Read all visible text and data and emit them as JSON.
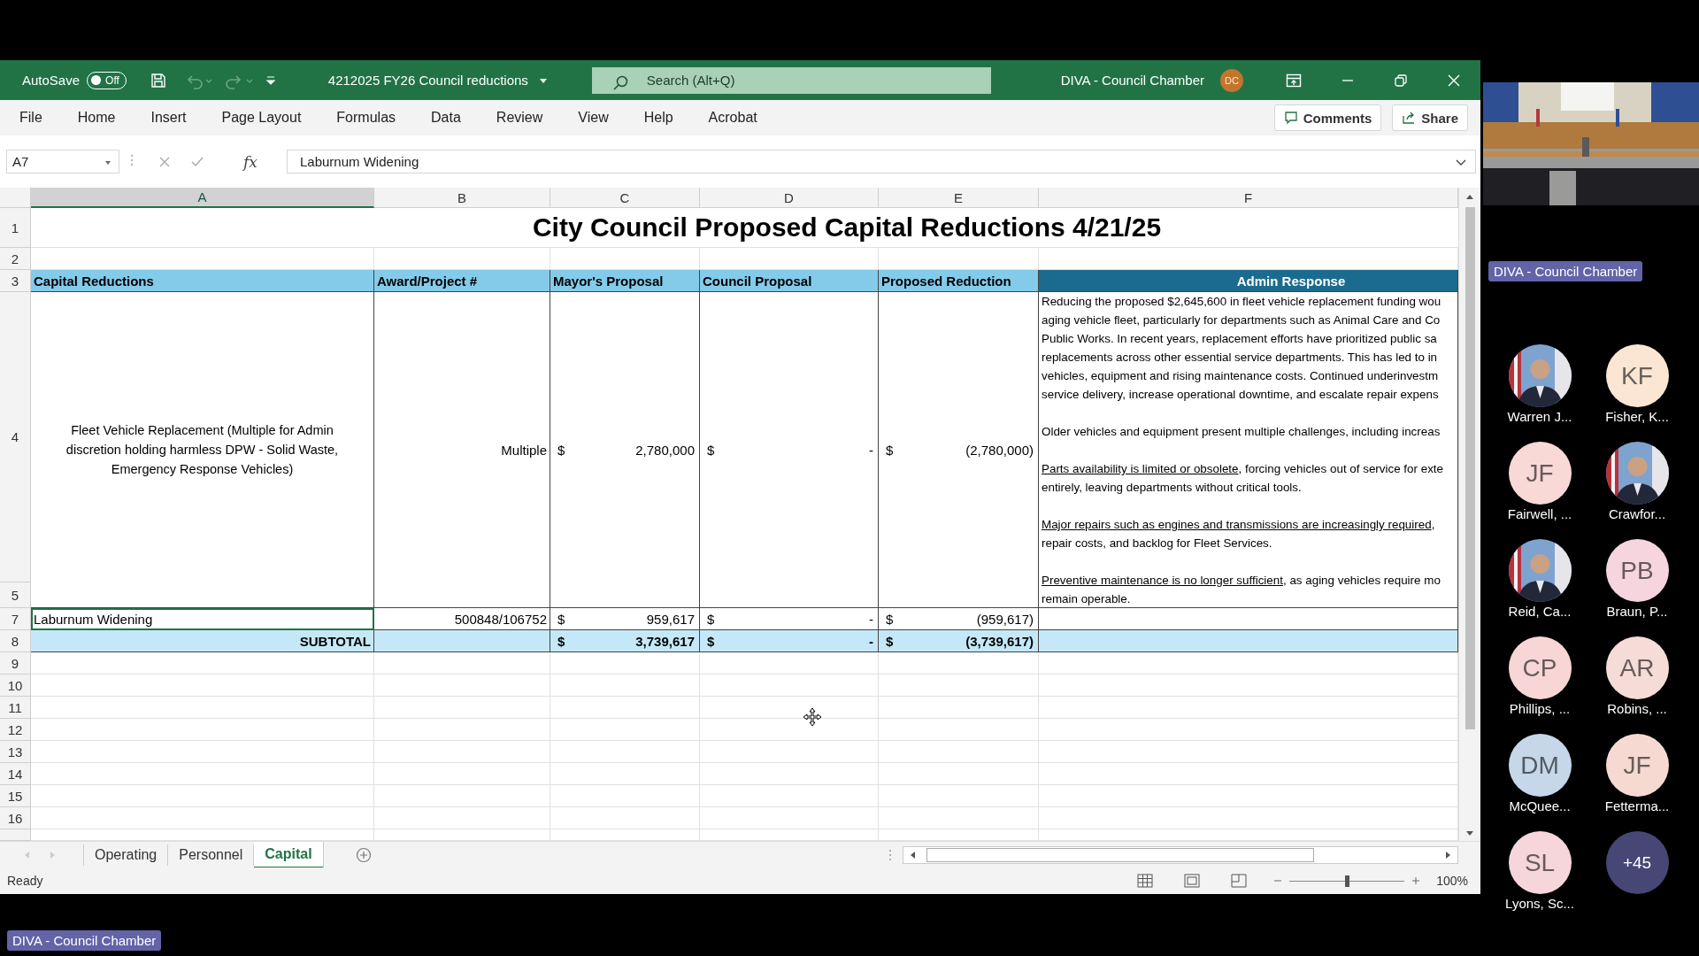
{
  "title_bar": {
    "autosave": {
      "label": "AutoSave",
      "state_label": "Off",
      "on": false
    },
    "document_title": "4212025 FY26 Council reductions",
    "search": {
      "placeholder": "Search (Alt+Q)"
    },
    "account": {
      "name": "DIVA - Council Chamber",
      "initials": "DC"
    }
  },
  "menu": [
    "File",
    "Home",
    "Insert",
    "Page Layout",
    "Formulas",
    "Data",
    "Review",
    "View",
    "Help",
    "Acrobat"
  ],
  "comments_button": "Comments",
  "share_button": "Share",
  "formula_bar": {
    "name_box": "A7",
    "function_label": "fx",
    "formula": "Laburnum Widening"
  },
  "columns": [
    {
      "label": "A",
      "selected": true
    },
    {
      "label": "B",
      "selected": false
    },
    {
      "label": "C",
      "selected": false
    },
    {
      "label": "D",
      "selected": false
    },
    {
      "label": "E",
      "selected": false
    },
    {
      "label": "F",
      "selected": false
    }
  ],
  "row_numbers": [
    "1",
    "2",
    "3",
    "4",
    "5",
    "7",
    "8",
    "9",
    "10",
    "11",
    "12",
    "13",
    "14",
    "15",
    "16"
  ],
  "sheet": {
    "title": "City Council Proposed Capital Reductions 4/21/25",
    "headers": [
      "Capital Reductions",
      "Award/Project #",
      "Mayor's Proposal",
      "Council Proposal",
      "Proposed Reduction",
      "Admin Response"
    ],
    "rows": [
      {
        "kind": "merged",
        "selected": false,
        "description": "Fleet Vehicle Replacement (Multiple for Admin discretion holding harmless DPW - Solid Waste, Emergency Response Vehicles)",
        "project": "Multiple",
        "mayor": {
          "currency": "$",
          "amount": "2,780,000"
        },
        "council": {
          "currency": "$",
          "amount": "-"
        },
        "reduction": {
          "currency": "$",
          "amount": "(2,780,000)"
        },
        "admin_response": [
          {
            "lines": [
              {
                "text": "Reducing the proposed $2,645,600 in fleet vehicle replacement funding wou"
              },
              {
                "text": "aging vehicle fleet, particularly for departments such as Animal Care and Co"
              },
              {
                "text": "Public Works. In recent years, replacement efforts have prioritized public sa"
              },
              {
                "text": "replacements across other essential service departments. This has led to in"
              },
              {
                "text": "vehicles, equipment and rising maintenance costs. Continued underinvestm"
              },
              {
                "text": "service delivery, increase operational downtime, and escalate repair expens"
              }
            ]
          },
          {
            "lines": [
              {
                "text": "Older vehicles and equipment present multiple challenges, including increas"
              }
            ]
          },
          {
            "lines": [
              {
                "underlined": "Parts availability is limited or obsolete",
                "text": ", forcing vehicles out of service for exte"
              },
              {
                "text": "entirely, leaving departments without critical tools."
              }
            ]
          },
          {
            "lines": [
              {
                "underlined": "Major repairs such as engines and transmissions are increasingly required",
                "text": ","
              },
              {
                "text": "repair costs, and backlog for Fleet Services."
              }
            ]
          },
          {
            "lines": [
              {
                "underlined": "Preventive maintenance is no longer sufficient",
                "text": ", as aging vehicles require mo"
              },
              {
                "text": "remain operable."
              }
            ]
          }
        ]
      },
      {
        "kind": "single",
        "selected": true,
        "description": "Laburnum Widening",
        "project": "500848/106752",
        "mayor": {
          "currency": "$",
          "amount": "959,617"
        },
        "council": {
          "currency": "$",
          "amount": "-"
        },
        "reduction": {
          "currency": "$",
          "amount": "(959,617)"
        }
      }
    ],
    "subtotal": {
      "label": "SUBTOTAL",
      "mayor": {
        "currency": "$",
        "amount": "3,739,617"
      },
      "council": {
        "currency": "$",
        "amount": "-"
      },
      "reduction": {
        "currency": "$",
        "amount": "(3,739,617)"
      }
    }
  },
  "sheet_tabs": [
    {
      "label": "Operating",
      "selected": false
    },
    {
      "label": "Personnel",
      "selected": false
    },
    {
      "label": "Capital",
      "selected": true
    }
  ],
  "status": "Ready",
  "zoom": {
    "level": 0.5,
    "label": "100%"
  },
  "meeting": {
    "video": {
      "kind": "picture"
    },
    "room_label": "DIVA - Council Chamber",
    "participant_rows": [
      [
        {
          "name": "Warren J..."
        },
        {
          "kind": "initials",
          "name": "Fisher, K...",
          "initials": "KF",
          "color": "#fbe6d4"
        }
      ],
      [
        {
          "kind": "initials",
          "name": "Fairwell, ...",
          "initials": "JF",
          "color": "#f9d9d6"
        },
        {
          "name": "Crawfor..."
        }
      ],
      [
        {
          "name": "Reid, Ca..."
        },
        {
          "kind": "initials",
          "name": "Braun, P...",
          "initials": "PB",
          "color": "#f6d5df"
        }
      ],
      [
        {
          "kind": "initials",
          "name": "Phillips, ...",
          "initials": "CP",
          "color": "#f8d6d6"
        },
        {
          "kind": "initials",
          "name": "Robins, ...",
          "initials": "AR",
          "color": "#f6dcd6"
        }
      ],
      [
        {
          "kind": "initials",
          "name": "McQuee...",
          "initials": "DM",
          "color": "#c6d7ea"
        },
        {
          "kind": "initials",
          "name": "Fetterma...",
          "initials": "JF",
          "color": "#f6dad2"
        }
      ],
      [
        {
          "kind": "initials",
          "name": "Lyons, Sc...",
          "initials": "SL",
          "color": "#f6d6da"
        }
      ]
    ],
    "overflow_count": "+45"
  },
  "bottom_label": "DIVA - Council Chamber"
}
